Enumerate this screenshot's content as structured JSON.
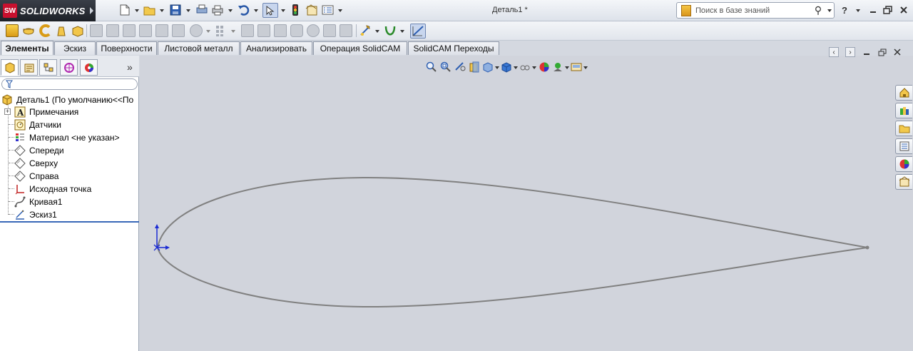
{
  "app": {
    "name": "SOLIDWORKS",
    "logo_mark": "SW"
  },
  "title_bar": {
    "document_title": "Деталь1 *"
  },
  "search": {
    "placeholder": "Поиск в базе знаний"
  },
  "help": {
    "label": "?"
  },
  "command_tabs": [
    {
      "label": "Элементы",
      "active": true
    },
    {
      "label": "Эскиз"
    },
    {
      "label": "Поверхности"
    },
    {
      "label": "Листовой металл"
    },
    {
      "label": "Анализировать"
    },
    {
      "label": "Операция  SolidCAM"
    },
    {
      "label": "SolidCAM Переходы"
    }
  ],
  "feature_tree": {
    "root": {
      "label": "Деталь1  (По умолчанию<<По"
    },
    "items": [
      {
        "label": "Примечания",
        "icon": "annotations-icon",
        "expandable": true
      },
      {
        "label": "Датчики",
        "icon": "sensors-icon"
      },
      {
        "label": "Материал <не указан>",
        "icon": "material-icon"
      },
      {
        "label": "Спереди",
        "icon": "plane-icon"
      },
      {
        "label": "Сверху",
        "icon": "plane-icon"
      },
      {
        "label": "Справа",
        "icon": "plane-icon"
      },
      {
        "label": "Исходная точка",
        "icon": "origin-icon"
      },
      {
        "label": "Кривая1",
        "icon": "curve-icon"
      },
      {
        "label": "Эскиз1",
        "icon": "sketch-icon"
      }
    ]
  },
  "sketch": {
    "curve_color": "#808080",
    "origin_color": "#1b2bd4"
  },
  "colors": {
    "titlebar": "#dde2ea",
    "viewport_bg": "#d1d4dc",
    "accent": "#3968b8"
  }
}
